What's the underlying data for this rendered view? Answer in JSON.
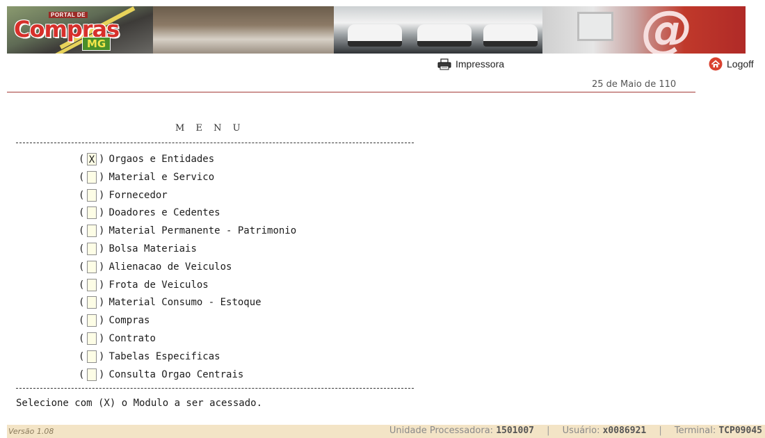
{
  "header": {
    "logo": {
      "portal_text": "PORTAL DE",
      "brand_text": "Compras",
      "region_text": "MG"
    },
    "print_label": "Impressora",
    "print_icon": "printer-icon",
    "logoff_label": "Logoff",
    "logoff_icon": "home-icon",
    "date": "25 de Maio de 110"
  },
  "menu": {
    "title": "M E N U",
    "options": [
      {
        "value": "X",
        "label": "Orgaos e Entidades"
      },
      {
        "value": "",
        "label": "Material e Servico"
      },
      {
        "value": "",
        "label": "Fornecedor"
      },
      {
        "value": "",
        "label": "Doadores e Cedentes"
      },
      {
        "value": "",
        "label": "Material Permanente - Patrimonio"
      },
      {
        "value": "",
        "label": "Bolsa Materiais"
      },
      {
        "value": "",
        "label": "Alienacao de Veiculos"
      },
      {
        "value": "",
        "label": "Frota de Veiculos"
      },
      {
        "value": "",
        "label": "Material Consumo - Estoque"
      },
      {
        "value": "",
        "label": "Compras"
      },
      {
        "value": "",
        "label": "Contrato"
      },
      {
        "value": "",
        "label": "Tabelas Especificas"
      },
      {
        "value": "",
        "label": "Consulta Orgao Centrais"
      }
    ],
    "instruction": "Selecione com (X) o Modulo a ser acessado."
  },
  "footer": {
    "version": "Versão 1.08",
    "unit_label": "Unidade Processadora:",
    "unit_value": "1501007",
    "user_label": "Usuário:",
    "user_value": "x0086921",
    "terminal_label": "Terminal:",
    "terminal_value": "TCP09045",
    "separator": "|"
  },
  "colors": {
    "accent_red": "#a33b36",
    "footer_bg": "#f3e4c6",
    "field_bg": "#fdfde6"
  }
}
